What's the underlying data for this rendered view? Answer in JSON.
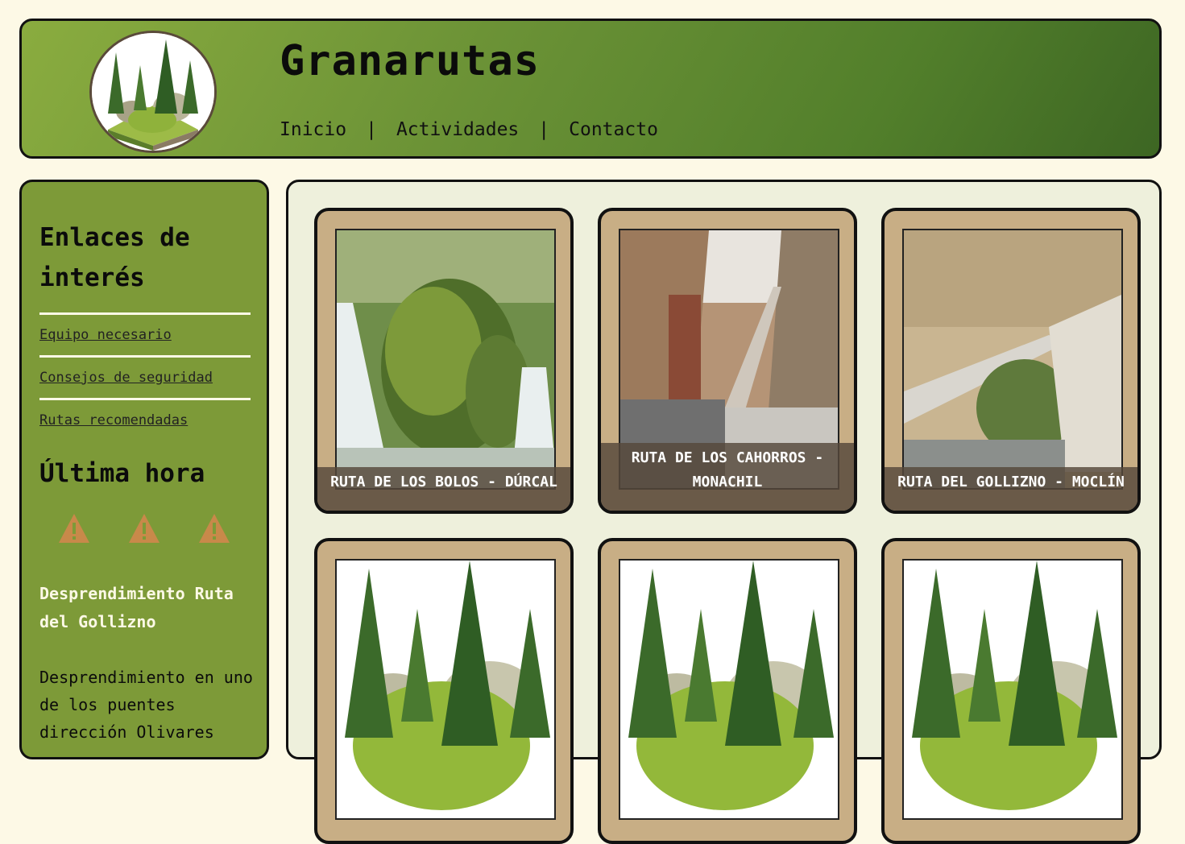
{
  "header": {
    "site_title": "Granarutas",
    "nav": [
      {
        "label": "Inicio"
      },
      {
        "label": "Actividades"
      },
      {
        "label": "Contacto"
      }
    ],
    "separator": "|"
  },
  "sidebar": {
    "title": "Enlaces de interés",
    "links": [
      {
        "label": "Equipo necesario"
      },
      {
        "label": "Consejos de seguridad"
      },
      {
        "label": "Rutas recomendadas"
      }
    ],
    "news_title": "Última hora",
    "news_headline": "Desprendimiento Ruta del Gollizno",
    "news_body": "Desprendimiento en uno de los puentes dirección Olivares"
  },
  "cards": [
    {
      "caption": "RUTA DE LOS BOLOS - DÚRCAL",
      "image": "waterfall-photo"
    },
    {
      "caption": "RUTA DE LOS CAHORROS - MONACHIL",
      "image": "suspension-bridge-photo"
    },
    {
      "caption": "RUTA DEL GOLLIZNO - MOCLÍN",
      "image": "cliff-bridge-photo"
    },
    {
      "caption": "",
      "image": "forest-logo-image"
    },
    {
      "caption": "",
      "image": "forest-logo-image"
    },
    {
      "caption": "",
      "image": "forest-logo-image"
    }
  ],
  "colors": {
    "page_bg": "#fdf9e6",
    "header_green": "#6b9236",
    "sidebar_green": "#7d9a38",
    "card_tan": "#c8ae85",
    "warning_orange": "#c8894a"
  }
}
